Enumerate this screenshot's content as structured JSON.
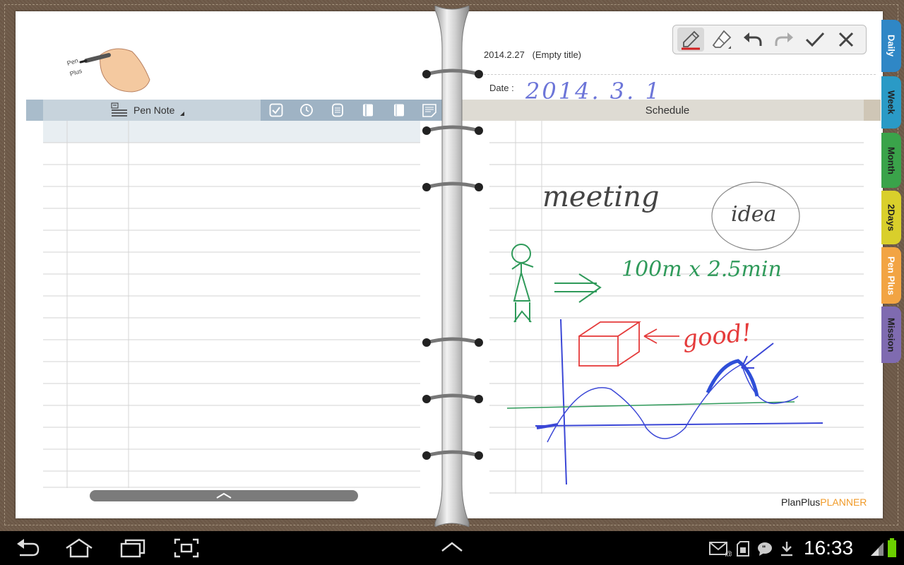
{
  "left_page": {
    "pen_note_label": "Pen Note",
    "logo_text": "Pen Plus",
    "toolbar_icons": [
      "checkbox-icon",
      "clock-icon",
      "list-icon",
      "notebook-icon",
      "notebook-alt-icon",
      "memo-icon"
    ]
  },
  "right_page": {
    "date_title": "2014.2.27   (Empty title)",
    "date_label": "Date :",
    "schedule_label": "Schedule",
    "handwriting": {
      "date": "2014. 3. 1",
      "meeting": "meeting",
      "idea": "idea",
      "measure": "100m x 2.5min",
      "good": "good!"
    },
    "brand_a": "PlanPlus",
    "brand_b": "PLANNER"
  },
  "pen_toolbar": {
    "tools": [
      "pen-icon",
      "eraser-icon",
      "undo-icon",
      "redo-icon",
      "confirm-icon",
      "close-icon"
    ],
    "active_tool": "pen-icon"
  },
  "tabs": [
    {
      "label": "Daily",
      "color": "#2f87c6"
    },
    {
      "label": "Week",
      "color": "#2a9ac6"
    },
    {
      "label": "Month",
      "color": "#3aa34a"
    },
    {
      "label": "2Days",
      "color": "#d9cf2b"
    },
    {
      "label": "Pen Plus",
      "color": "#f2a443"
    },
    {
      "label": "Mission",
      "color": "#7f6bb0"
    }
  ],
  "status_bar": {
    "time": "16:33",
    "nav_icons": [
      "back-icon",
      "home-icon",
      "recent-apps-icon",
      "screenshot-icon"
    ],
    "center_icon": "chevron-up-icon",
    "notification_icons": [
      "email-icon",
      "sim-icon",
      "chat-icon",
      "download-icon"
    ],
    "signal_icon": "signal-icon",
    "battery_icon": "battery-icon"
  },
  "colors": {
    "leather": "#6e5a48",
    "pen_bar": "#c7d3dc",
    "schedule_bar": "#dedbd3",
    "ink_blue": "#3b47d6",
    "ink_green": "#2f9a5a",
    "ink_red": "#e53b3b",
    "brand_orange": "#f09a28"
  }
}
